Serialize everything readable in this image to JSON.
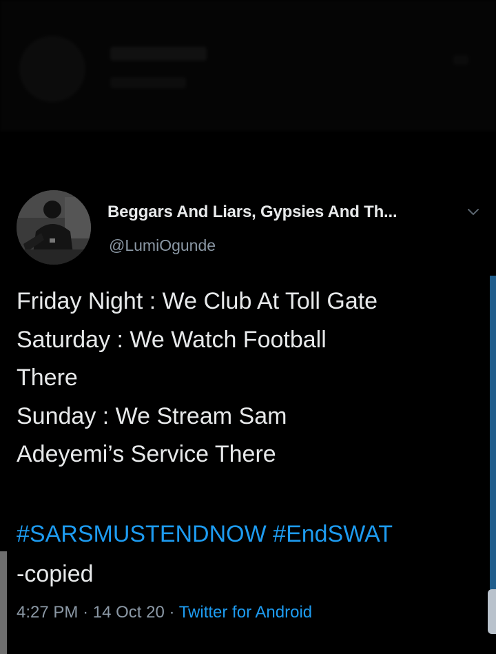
{
  "tweet": {
    "display_name": "Beggars And Liars, Gypsies And Th...",
    "handle": "@LumiOgunde",
    "lines": [
      "Friday Night : We Club At Toll Gate",
      "Saturday : We Watch Football",
      "There",
      "Sunday : We Stream Sam",
      "Adeyemi’s Service There"
    ],
    "hashtags": [
      "#SARSMUSTENDNOW",
      "#EndSWAT"
    ],
    "copied": "-copied",
    "time": "4:27 PM",
    "date": "14 Oct 20",
    "source": "Twitter for Android"
  },
  "colors": {
    "background": "#000000",
    "text": "#e7e9ea",
    "secondary": "#8b98a5",
    "link": "#1d9bf0"
  },
  "icons": {
    "avatar": "profile-photo",
    "chevron": "chevron-down-icon"
  }
}
